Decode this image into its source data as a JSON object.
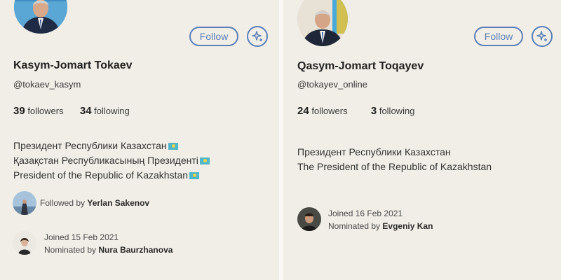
{
  "left": {
    "follow_label": "Follow",
    "name": "Kasym-Jomart Tokaev",
    "handle": "@tokaev_kasym",
    "followers_count": "39",
    "followers_label": "followers",
    "following_count": "34",
    "following_label": "following",
    "bio": [
      "Президент Республики Казахстан",
      "Қазақстан Республикасының Президенті",
      "President of the Republic of Kazakhstan"
    ],
    "followed_by_prefix": "Followed by",
    "followed_by_name": "Yerlan Sakenov",
    "joined": "Joined 15 Feb 2021",
    "nominated_prefix": "Nominated by",
    "nominated_name": "Nura Baurzhanova"
  },
  "right": {
    "follow_label": "Follow",
    "name": "Qasym-Jomart Toqayev",
    "handle": "@tokayev_online",
    "followers_count": "24",
    "followers_label": "followers",
    "following_count": "3",
    "following_label": "following",
    "bio": [
      "Президент Республики Казахстан",
      "The President of the Republic of Kazakhstan"
    ],
    "joined": "Joined 16 Feb 2021",
    "nominated_prefix": "Nominated by",
    "nominated_name": "Evgeniy Kan"
  },
  "colors": {
    "accent": "#5a7fb8",
    "background": "#f1eee7",
    "flag": "#4fb7c9"
  },
  "icons": {
    "spark": "sparkle-plus-icon",
    "flag": "kazakhstan-flag-icon"
  }
}
